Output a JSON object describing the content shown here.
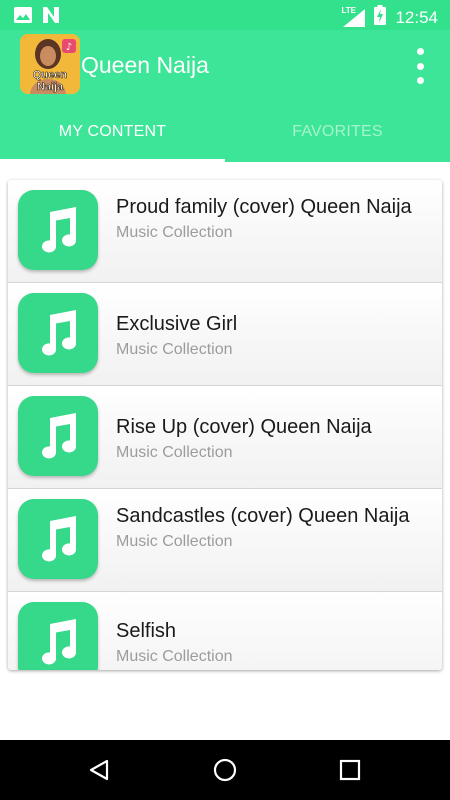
{
  "status_bar": {
    "time": "12:54",
    "network_label": "LTE",
    "icons": [
      "image-icon",
      "n-app-icon",
      "signal-icon",
      "battery-charging-icon"
    ]
  },
  "app_bar": {
    "title": "Queen Naija",
    "logo_text_line1": "Queen",
    "logo_text_line2": "Naija",
    "menu_icon": "overflow-menu-icon"
  },
  "tabs": [
    {
      "label": "MY CONTENT",
      "active": true
    },
    {
      "label": "FAVORITES",
      "active": false
    }
  ],
  "list": {
    "items": [
      {
        "title": "Proud family (cover) Queen Naija",
        "subtitle": "Music Collection",
        "icon": "music-note-icon"
      },
      {
        "title": "Exclusive Girl",
        "subtitle": "Music Collection",
        "icon": "music-note-icon"
      },
      {
        "title": "Rise Up (cover) Queen Naija",
        "subtitle": "Music Collection",
        "icon": "music-note-icon"
      },
      {
        "title": "Sandcastles (cover) Queen Naija",
        "subtitle": "Music Collection",
        "icon": "music-note-icon"
      },
      {
        "title": "Selfish",
        "subtitle": "Music Collection",
        "icon": "music-note-icon"
      }
    ]
  },
  "nav_bar": {
    "icons": [
      "back-icon",
      "home-icon",
      "recents-icon"
    ]
  },
  "colors": {
    "accent": "#3de598",
    "status_bar": "#33e08c",
    "icon_tile": "#36d98a",
    "tab_inactive": "#a6f3cc"
  }
}
